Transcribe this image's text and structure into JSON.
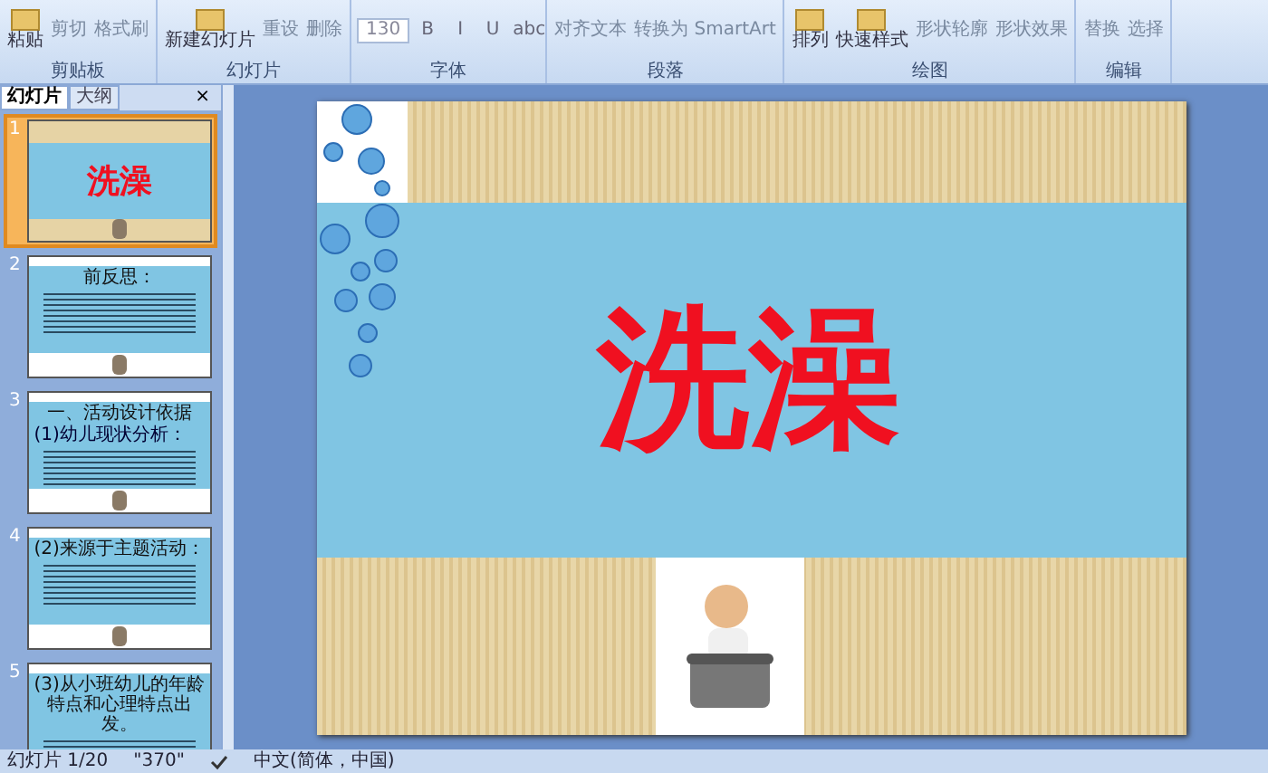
{
  "ribbon": {
    "groups": [
      {
        "label": "剪贴板",
        "buttons": [
          {
            "label": "粘贴",
            "kind": "large"
          },
          {
            "label": "剪切",
            "kind": "small"
          },
          {
            "label": "格式刷",
            "kind": "small"
          }
        ]
      },
      {
        "label": "幻灯片",
        "buttons": [
          {
            "label": "新建幻灯片",
            "kind": "large"
          },
          {
            "label": "重设",
            "kind": "small"
          },
          {
            "label": "删除",
            "kind": "small"
          }
        ]
      },
      {
        "label": "字体",
        "buttons": [
          {
            "label": "130",
            "kind": "field"
          },
          {
            "label": "B",
            "kind": "glyph"
          },
          {
            "label": "I",
            "kind": "glyph"
          },
          {
            "label": "U",
            "kind": "glyph"
          },
          {
            "label": "abc",
            "kind": "glyph"
          }
        ]
      },
      {
        "label": "段落",
        "buttons": [
          {
            "label": "对齐文本",
            "kind": "small"
          },
          {
            "label": "转换为 SmartArt",
            "kind": "small"
          }
        ]
      },
      {
        "label": "绘图",
        "buttons": [
          {
            "label": "排列",
            "kind": "large"
          },
          {
            "label": "快速样式",
            "kind": "large"
          },
          {
            "label": "形状轮廓",
            "kind": "small"
          },
          {
            "label": "形状效果",
            "kind": "small"
          }
        ]
      },
      {
        "label": "编辑",
        "buttons": [
          {
            "label": "替换",
            "kind": "small"
          },
          {
            "label": "选择",
            "kind": "small"
          }
        ]
      }
    ]
  },
  "panel": {
    "tabs": [
      {
        "label": "幻灯片",
        "selected": true
      },
      {
        "label": "大纲",
        "selected": false
      }
    ],
    "close": "×"
  },
  "slides": [
    {
      "number": "1",
      "selected": true,
      "kind": "title",
      "title": "洗澡"
    },
    {
      "number": "2",
      "selected": false,
      "kind": "text",
      "title": "前反思："
    },
    {
      "number": "3",
      "selected": false,
      "kind": "text",
      "title": "一、活动设计依据",
      "subtitle": "(1)幼儿现状分析："
    },
    {
      "number": "4",
      "selected": false,
      "kind": "text",
      "title": "(2)来源于主题活动："
    },
    {
      "number": "5",
      "selected": false,
      "kind": "text",
      "title": "(3)从小班幼儿的年龄特点和心理特点出发。"
    }
  ],
  "main_slide": {
    "title": "洗澡"
  },
  "status_bar": {
    "slide": "幻灯片 1/20",
    "theme": "\"370\"",
    "language": "中文(简体，中国)"
  }
}
